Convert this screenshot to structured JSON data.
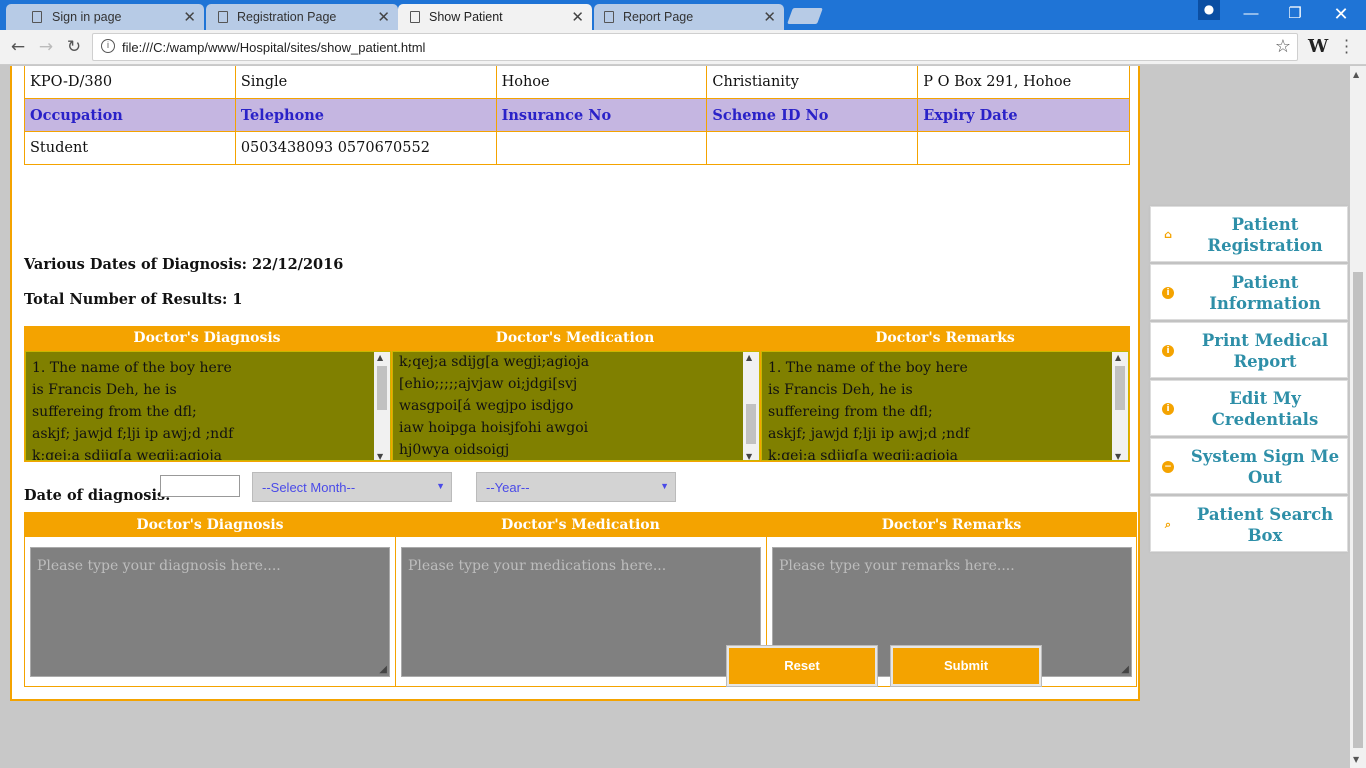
{
  "browser": {
    "tabs": [
      {
        "label": "Sign in page"
      },
      {
        "label": "Registration Page"
      },
      {
        "label": "Show Patient"
      },
      {
        "label": "Report Page"
      }
    ],
    "url": "file:///C:/wamp/www/Hospital/sites/show_patient.html"
  },
  "patient_table": {
    "row1": [
      "KPO-D/380",
      "Single",
      "Hohoe",
      "Christianity",
      "P O Box 291, Hohoe"
    ],
    "headers2": [
      "Occupation",
      "Telephone",
      "Insurance No",
      "Scheme ID No",
      "Expiry Date"
    ],
    "row2": [
      "Student",
      "0503438093 0570670552",
      "",
      "",
      ""
    ]
  },
  "summary": {
    "various_dates": "Various Dates of Diagnosis: 22/12/2016",
    "total_results": "Total Number of Results: 1"
  },
  "results": {
    "headers": [
      "Doctor's Diagnosis",
      "Doctor's Medication",
      "Doctor's Remarks"
    ],
    "diagnosis": "1. The name of the boy here\nis Francis Deh, he is\nsuffereing from the dfl;\naskjf; jawjd f;lji ip awj;d ;ndf\nk;qej;a sdjjg[a wegji;agioja",
    "medication": "k;qej;a sdijg[a wegji;agioja\n[ehio;;;;;ajvjaw oi;jdgi[svj\nwasgpoi[á wegjpo isdjgo\niaw hoipga hoisjfohi awgoi\nhj0wya oidsoigj",
    "remarks": "1. The name of the boy here\nis Francis Deh, he is\nsuffereing from the dfl;\naskjf; jawjd f;lji ip awj;d ;ndf\nk;qej;a sdjjg[a wegji;agioja"
  },
  "form": {
    "date_label": "Date of diagnosis:",
    "month_select": "--Select Month--",
    "year_select": "--Year--",
    "headers": [
      "Doctor's Diagnosis",
      "Doctor's Medication",
      "Doctor's Remarks"
    ],
    "diagnosis_placeholder": "Please type your diagnosis here....",
    "medication_placeholder": "Please type your medications here...",
    "remarks_placeholder": "Please type your remarks here....",
    "reset_label": "Reset",
    "submit_label": "Submit"
  },
  "side_menu": [
    {
      "label": "Patient Registration",
      "icon": "home-icon"
    },
    {
      "label": "Patient Information",
      "icon": "info-icon"
    },
    {
      "label": "Print Medical Report",
      "icon": "info-icon"
    },
    {
      "label": "Edit My Credentials",
      "icon": "info-icon"
    },
    {
      "label": "System Sign Me Out",
      "icon": "minus-circle-icon"
    },
    {
      "label": "Patient Search Box",
      "icon": "search-icon"
    }
  ],
  "colors": {
    "accent": "#f4a300",
    "header_bg": "#c5b6e1",
    "header_text": "#2a22c8",
    "result_bg": "#808000",
    "menu_text": "#2e8fa8"
  }
}
